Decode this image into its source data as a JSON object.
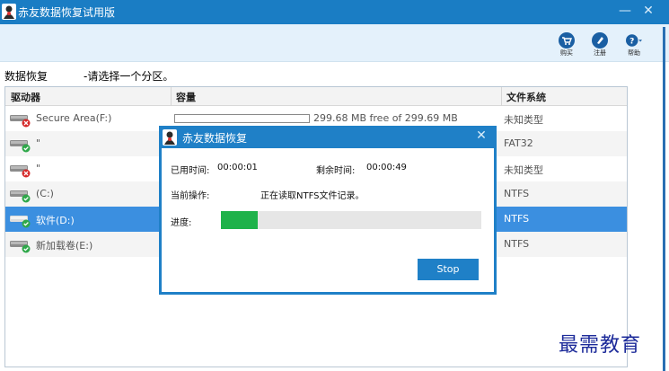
{
  "window": {
    "title": "赤友数据恢复试用版",
    "minimize_glyph": "—",
    "close_glyph": "✕"
  },
  "toolbar": {
    "buy_label": "购买",
    "buy_icon": "cart-icon",
    "register_label": "注册",
    "register_icon": "register-icon",
    "help_label": "帮助",
    "help_icon": "help-icon"
  },
  "breadcrumb": {
    "title": "数据恢复",
    "hint": "-请选择一个分区。"
  },
  "table": {
    "columns": [
      "驱动器",
      "容量",
      "文件系统"
    ],
    "rows": [
      {
        "name": "Secure Area(F:)",
        "capacity": "299.68 MB free of 299.69 MB",
        "filesystem": "未知类型",
        "status": "error"
      },
      {
        "name": "\"",
        "capacity": "",
        "filesystem": "FAT32",
        "status": "ok"
      },
      {
        "name": "\"",
        "capacity": "",
        "filesystem": "未知类型",
        "status": "error"
      },
      {
        "name": "(C:)",
        "capacity": "",
        "filesystem": "NTFS",
        "status": "ok"
      },
      {
        "name": "软件(D:)",
        "capacity": "",
        "filesystem": "NTFS",
        "status": "ok",
        "selected": true
      },
      {
        "name": "新加载卷(E:)",
        "capacity": "",
        "filesystem": "NTFS",
        "status": "ok"
      }
    ]
  },
  "dialog": {
    "title": "赤友数据恢复",
    "close_glyph": "✕",
    "elapsed_label": "已用时间:",
    "elapsed_value": "00:00:01",
    "remaining_label": "剩余时间:",
    "remaining_value": "00:00:49",
    "operation_label": "当前操作:",
    "operation_value": "正在读取NTFS文件记录。",
    "progress_label": "进度:",
    "progress_fraction": 0.14,
    "stop_label": "Stop"
  },
  "watermark": "最需教育",
  "colors": {
    "accent": "#1f80c7",
    "selected_row": "#3b8fe0",
    "progress": "#1fb24a"
  }
}
